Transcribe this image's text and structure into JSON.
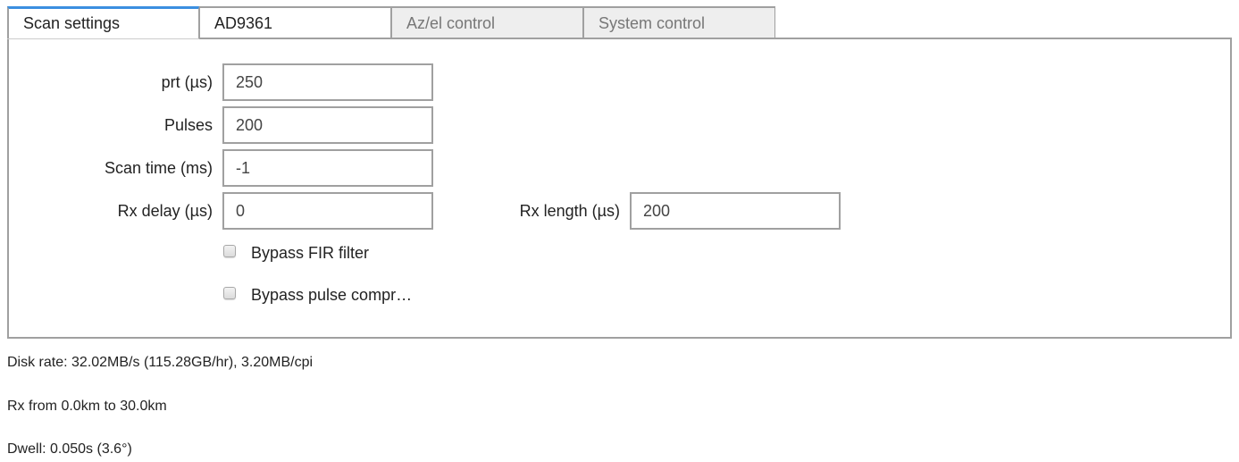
{
  "tabs": [
    {
      "label": "Scan settings",
      "state": "active"
    },
    {
      "label": "AD9361",
      "state": "inactive"
    },
    {
      "label": "Az/el control",
      "state": "disabled"
    },
    {
      "label": "System control",
      "state": "disabled"
    }
  ],
  "form": {
    "prt": {
      "label": "prt (µs)",
      "value": "250"
    },
    "pulses": {
      "label": "Pulses",
      "value": "200"
    },
    "scan_time": {
      "label": "Scan time (ms)",
      "value": "-1"
    },
    "rx_delay": {
      "label": "Rx delay (µs)",
      "value": "0"
    },
    "rx_length": {
      "label": "Rx length (µs)",
      "value": "200"
    },
    "bypass_fir": {
      "label": "Bypass FIR filter",
      "checked": false
    },
    "bypass_pulse": {
      "label": "Bypass pulse compr…",
      "checked": false
    }
  },
  "info": {
    "disk_rate": "Disk rate: 32.02MB/s (115.28GB/hr), 3.20MB/cpi",
    "rx_range": "Rx from 0.0km to 30.0km",
    "dwell": "Dwell: 0.050s (3.6°)"
  },
  "colors": {
    "active_tab_accent": "#3b8fe0",
    "border": "#a0a0a0",
    "disabled_tab_bg": "#eeeeee"
  }
}
